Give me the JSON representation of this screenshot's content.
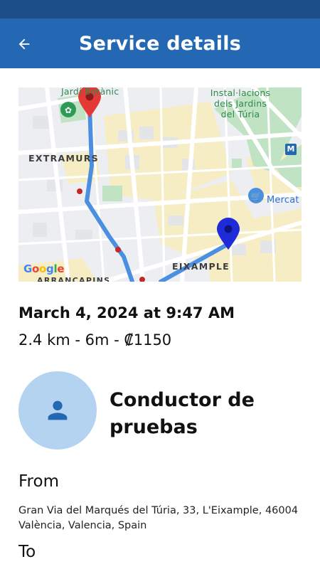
{
  "header": {
    "title": "Service details",
    "back_icon": "arrow-left-icon"
  },
  "colors": {
    "status_bar": "#1c4f8a",
    "app_bar": "#2468b4",
    "route_line": "#4a8fe0",
    "origin_pin": "#e53935",
    "destination_pin": "#1e2bd6",
    "avatar_bg": "#b3d3f0",
    "avatar_icon": "#2468b4"
  },
  "map": {
    "labels": {
      "garden_top": "Jardí Botànic",
      "installations": "Instal·lacions\ndels Jardins\ndel Túria",
      "extramurs": "EXTRAMURS",
      "mercat": "Mercat",
      "eixample": "EIXAMPLE",
      "arrancapins": "ARRANCAPINS"
    },
    "metro_badge": "M",
    "attribution": "Google",
    "pins": [
      "origin-pin",
      "destination-pin"
    ]
  },
  "trip": {
    "date": "March 4, 2024 at 9:47 AM",
    "summary": "2.4 km - 6m - ₡1150"
  },
  "driver": {
    "name": "Conductor de pruebas",
    "avatar_icon": "person-icon"
  },
  "route": {
    "from_label": "From",
    "from_address": "Gran Via del Marqués del Túria, 33, L'Eixample, 46004 València, Valencia, Spain",
    "to_label": "To"
  }
}
